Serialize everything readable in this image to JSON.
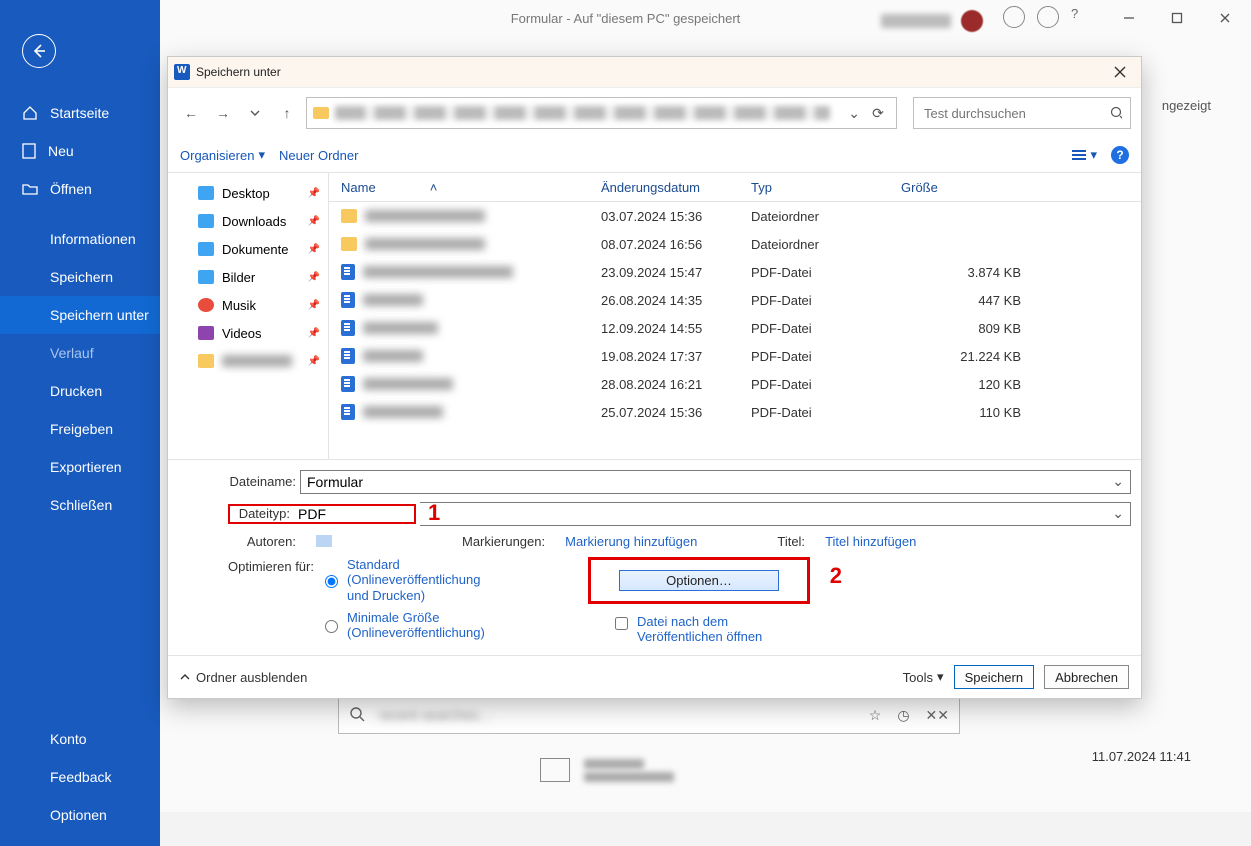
{
  "word_title": "Formular - Auf \"diesem PC\" gespeichert",
  "sidebar": {
    "home": "Startseite",
    "new": "Neu",
    "open": "Öffnen",
    "info": "Informationen",
    "save": "Speichern",
    "saveas": "Speichern unter",
    "history": "Verlauf",
    "print": "Drucken",
    "share": "Freigeben",
    "export": "Exportieren",
    "close": "Schließen",
    "account": "Konto",
    "feedback": "Feedback",
    "options": "Optionen"
  },
  "main_heading": "Speichern unter",
  "side_text_right": "ngezeigt",
  "file_date_right": "11.07.2024 11:41",
  "dialog": {
    "title": "Speichern unter",
    "search_placeholder": "Test durchsuchen",
    "toolbar": {
      "organize": "Organisieren",
      "new_folder": "Neuer Ordner"
    },
    "tree": {
      "desktop": "Desktop",
      "downloads": "Downloads",
      "documents": "Dokumente",
      "pictures": "Bilder",
      "music": "Musik",
      "videos": "Videos"
    },
    "columns": {
      "name": "Name",
      "modified": "Änderungsdatum",
      "type": "Typ",
      "size": "Größe"
    },
    "rows": [
      {
        "icon": "folder",
        "nameWidth": 120,
        "modified": "03.07.2024 15:36",
        "type": "Dateiordner",
        "size": ""
      },
      {
        "icon": "folder",
        "nameWidth": 120,
        "modified": "08.07.2024 16:56",
        "type": "Dateiordner",
        "size": ""
      },
      {
        "icon": "pdf",
        "nameWidth": 150,
        "modified": "23.09.2024 15:47",
        "type": "PDF-Datei",
        "size": "3.874 KB"
      },
      {
        "icon": "pdf",
        "nameWidth": 60,
        "modified": "26.08.2024 14:35",
        "type": "PDF-Datei",
        "size": "447 KB"
      },
      {
        "icon": "pdf",
        "nameWidth": 75,
        "modified": "12.09.2024 14:55",
        "type": "PDF-Datei",
        "size": "809 KB"
      },
      {
        "icon": "pdf",
        "nameWidth": 60,
        "modified": "19.08.2024 17:37",
        "type": "PDF-Datei",
        "size": "21.224 KB"
      },
      {
        "icon": "pdf",
        "nameWidth": 90,
        "modified": "28.08.2024 16:21",
        "type": "PDF-Datei",
        "size": "120 KB"
      },
      {
        "icon": "pdf",
        "nameWidth": 80,
        "modified": "25.07.2024 15:36",
        "type": "PDF-Datei",
        "size": "110 KB"
      }
    ],
    "filename_label": "Dateiname:",
    "filename_value": "Formular",
    "filetype_label": "Dateityp:",
    "filetype_value": "PDF",
    "authors_label": "Autoren:",
    "tags_label": "Markierungen:",
    "tags_link": "Markierung hinzufügen",
    "title_label": "Titel:",
    "title_link": "Titel hinzufügen",
    "optimize_label": "Optimieren für:",
    "opt_standard": "Standard (Onlineveröffentlichung und Drucken)",
    "opt_minimal": "Minimale Größe (Onlineveröffentlichung)",
    "options_btn": "Optionen…",
    "open_after": "Datei nach dem Veröffentlichen öffnen",
    "toggle_folders": "Ordner ausblenden",
    "tools": "Tools",
    "save_btn": "Speichern",
    "cancel_btn": "Abbrechen",
    "annotation1": "1",
    "annotation2": "2"
  }
}
